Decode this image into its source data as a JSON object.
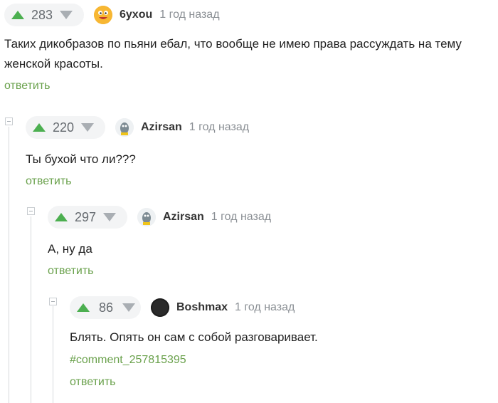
{
  "comments": [
    {
      "score": "283",
      "username": "6yxou",
      "time": "1 год назад",
      "text": "Таких дикобразов по пьяни ебал, что вообще не имею права рассуждать на тему женской красоты.",
      "reply": "ответить",
      "avatar_icon": "emoji-face-icon"
    },
    {
      "score": "220",
      "username": "Azirsan",
      "time": "1 год назад",
      "text": "Ты бухой что ли???",
      "reply": "ответить",
      "avatar_icon": "cartoon-avatar-icon"
    },
    {
      "score": "297",
      "username": "Azirsan",
      "time": "1 год назад",
      "text": "А, ну да",
      "reply": "ответить",
      "avatar_icon": "cartoon-avatar-icon"
    },
    {
      "score": "86",
      "username": "Boshmax",
      "time": "1 год назад",
      "text": "Блять. Опять он сам с собой разговаривает.",
      "link": "#comment_257815395",
      "reply": "ответить",
      "avatar_icon": "dark-circle-avatar-icon"
    }
  ],
  "colors": {
    "accent": "#6aa14c",
    "upvote": "#4caf50",
    "downvote": "#a9aeb3"
  }
}
